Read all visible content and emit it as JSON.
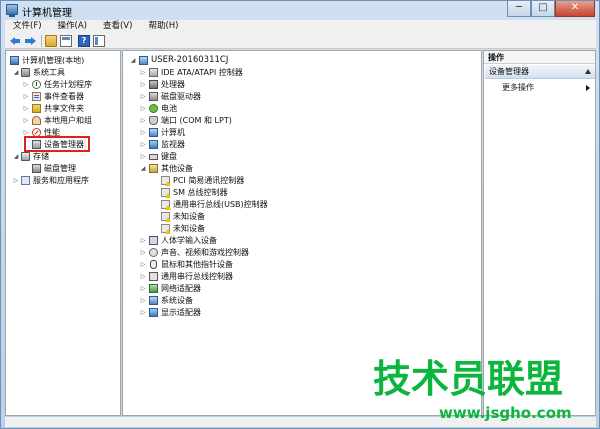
{
  "window": {
    "title": "计算机管理",
    "controls": {
      "minimize": "─",
      "maximize": "□",
      "close": "✕"
    }
  },
  "menu": [
    "文件(F)",
    "操作(A)",
    "查看(V)",
    "帮助(H)"
  ],
  "left_tree": {
    "root": "计算机管理(本地)",
    "system_tools": "系统工具",
    "task_scheduler": "任务计划程序",
    "event_viewer": "事件查看器",
    "shared_folders": "共享文件夹",
    "local_users": "本地用户和组",
    "performance": "性能",
    "device_manager": "设备管理器",
    "storage": "存储",
    "disk_management": "磁盘管理",
    "services_apps": "服务和应用程序"
  },
  "devices": {
    "computer_name": "USER-20160311CJ",
    "categories": [
      {
        "label": "IDE ATA/ATAPI 控制器",
        "icon": "ide-controller-icon"
      },
      {
        "label": "处理器",
        "icon": "processor-icon"
      },
      {
        "label": "磁盘驱动器",
        "icon": "disk-drive-icon"
      },
      {
        "label": "电池",
        "icon": "battery-icon"
      },
      {
        "label": "端口 (COM 和 LPT)",
        "icon": "port-icon"
      },
      {
        "label": "计算机",
        "icon": "computer-icon"
      },
      {
        "label": "监视器",
        "icon": "monitor-icon"
      },
      {
        "label": "键盘",
        "icon": "keyboard-icon"
      }
    ],
    "other_devices": {
      "label": "其他设备",
      "items": [
        "PCI 简易通讯控制器",
        "SM 总线控制器",
        "通用串行总线(USB)控制器",
        "未知设备",
        "未知设备"
      ]
    },
    "more_categories": [
      {
        "label": "人体学输入设备",
        "icon": "hid-icon"
      },
      {
        "label": "声音、视频和游戏控制器",
        "icon": "sound-icon"
      },
      {
        "label": "鼠标和其他指针设备",
        "icon": "mouse-icon"
      },
      {
        "label": "通用串行总线控制器",
        "icon": "usb-icon"
      },
      {
        "label": "网络适配器",
        "icon": "network-adapter-icon"
      },
      {
        "label": "系统设备",
        "icon": "system-device-icon"
      },
      {
        "label": "显示适配器",
        "icon": "display-adapter-icon"
      }
    ]
  },
  "actions": {
    "header": "操作",
    "section": "设备管理器",
    "more": "更多操作"
  },
  "watermark": {
    "main": "技术员联盟",
    "url": "www.jsgho.com"
  },
  "colors": {
    "highlight": "#e02020",
    "watermark": "#0cb53c"
  }
}
